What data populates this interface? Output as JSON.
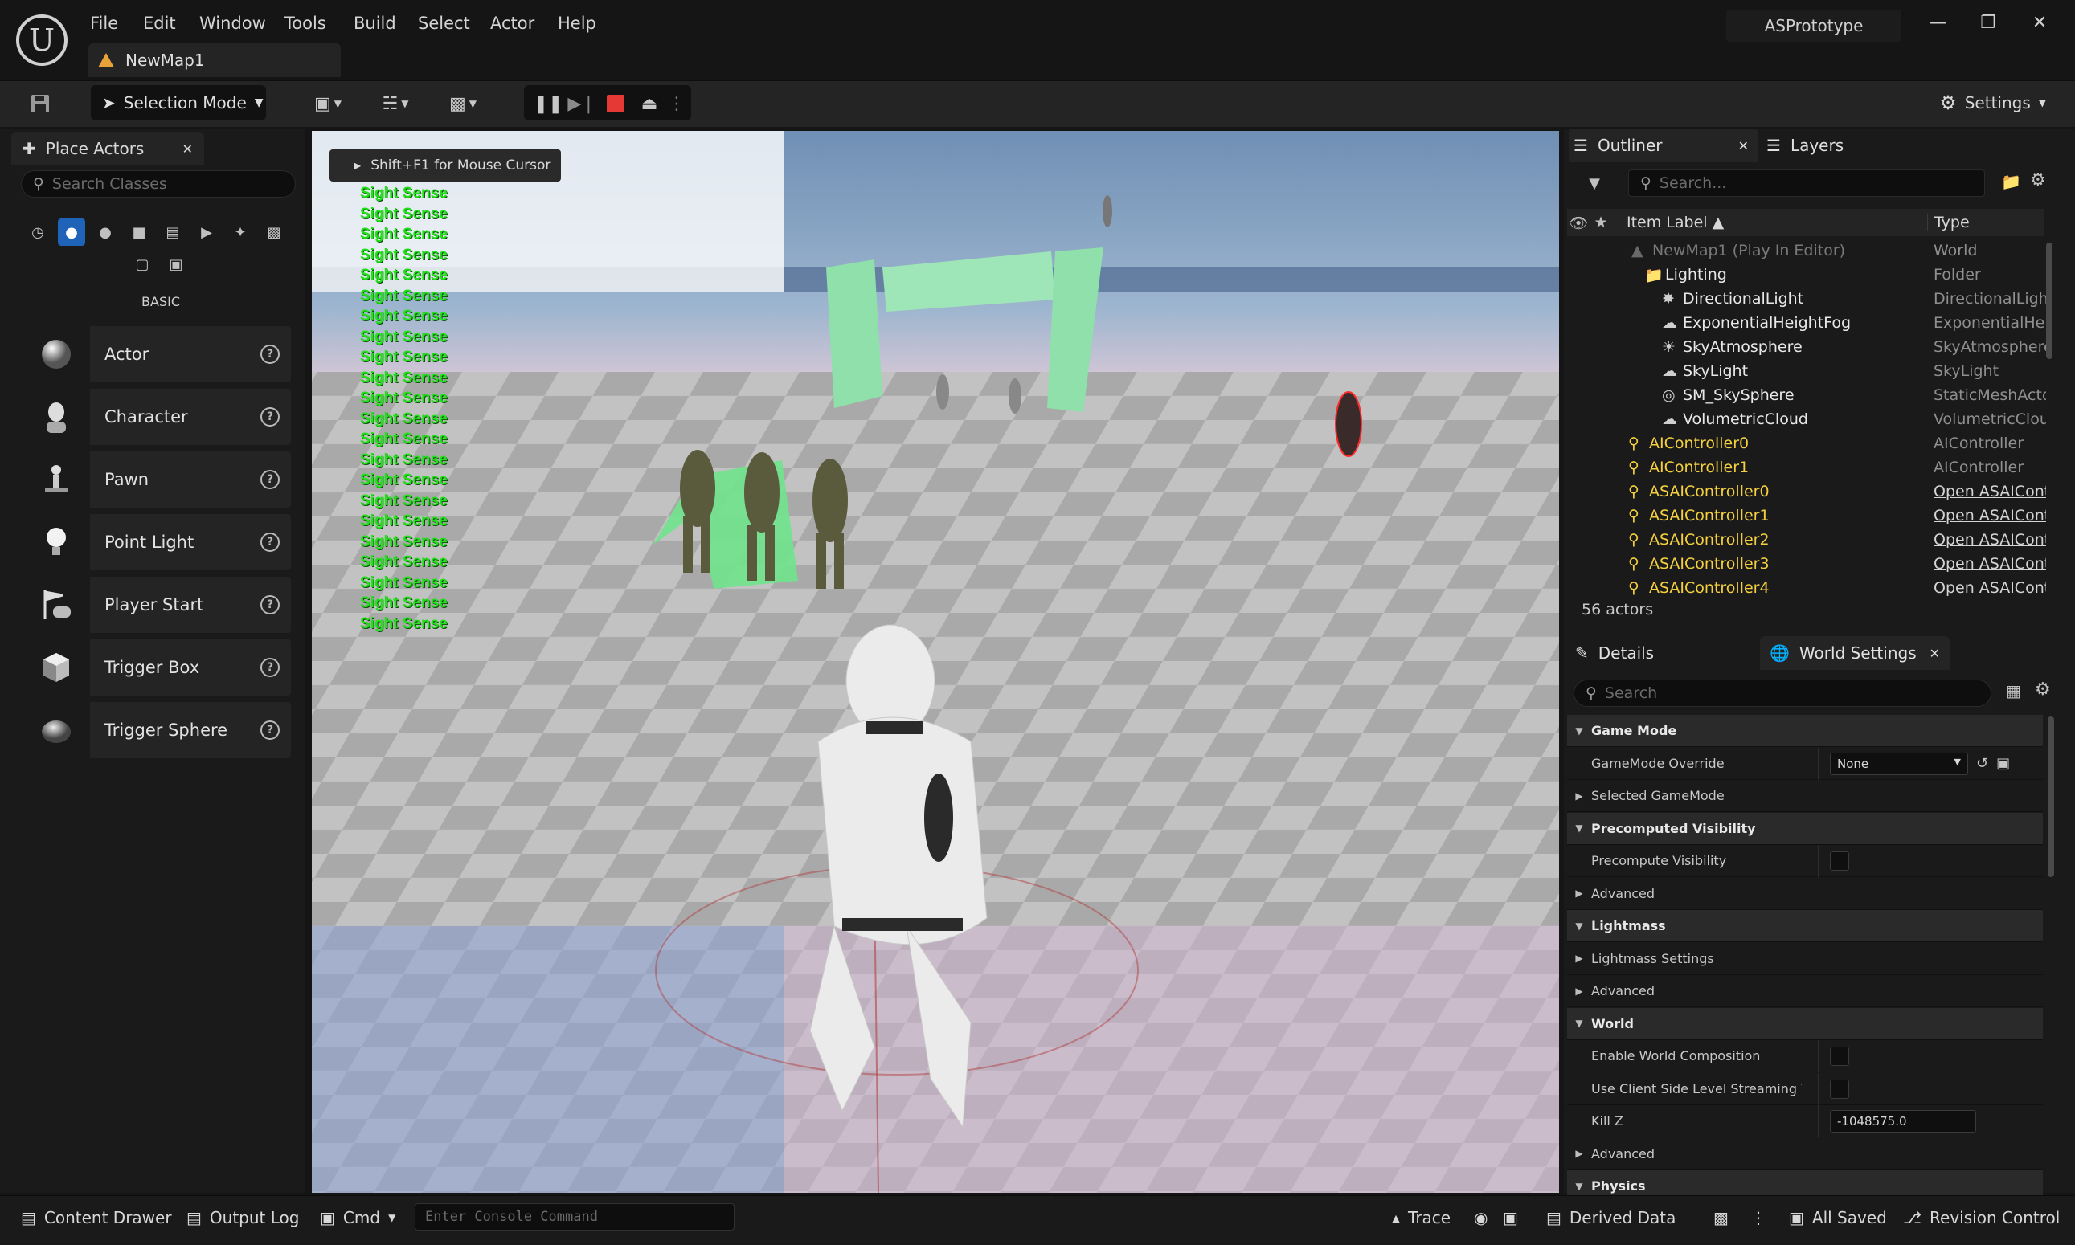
{
  "menu": [
    "File",
    "Edit",
    "Window",
    "Tools",
    "Build",
    "Select",
    "Actor",
    "Help"
  ],
  "project_name": "ASPrototype",
  "doc_tab": "NewMap1",
  "toolbar": {
    "selection_mode": "Selection Mode",
    "settings": "Settings"
  },
  "place_actors": {
    "tab_label": "Place Actors",
    "search_placeholder": "Search Classes",
    "category_label": "BASIC",
    "items": [
      "Actor",
      "Character",
      "Pawn",
      "Point Light",
      "Player Start",
      "Trigger Box",
      "Trigger Sphere"
    ]
  },
  "viewport": {
    "hint": "Shift+F1 for Mouse Cursor",
    "debug_lines": [
      "Sight Sense",
      "Sight Sense",
      "Sight Sense",
      "Sight Sense",
      "Sight Sense",
      "Sight Sense",
      "Sight Sense",
      "Sight Sense",
      "Sight Sense",
      "Sight Sense",
      "Sight Sense",
      "Sight Sense",
      "Sight Sense",
      "Sight Sense",
      "Sight Sense",
      "Sight Sense",
      "Sight Sense",
      "Sight Sense",
      "Sight Sense",
      "Sight Sense",
      "Sight Sense",
      "Sight Sense"
    ]
  },
  "outliner": {
    "tab_label": "Outliner",
    "layers_label": "Layers",
    "search_placeholder": "Search...",
    "col_label": "Item Label ▲",
    "col_type": "Type",
    "rows": [
      {
        "name": "NewMap1 (Play In Editor)",
        "type": "World"
      },
      {
        "name": "Lighting",
        "type": "Folder"
      },
      {
        "name": "DirectionalLight",
        "type": "DirectionalLight"
      },
      {
        "name": "ExponentialHeightFog",
        "type": "ExponentialHeig"
      },
      {
        "name": "SkyAtmosphere",
        "type": "SkyAtmosphere"
      },
      {
        "name": "SkyLight",
        "type": "SkyLight"
      },
      {
        "name": "SM_SkySphere",
        "type": "StaticMeshActo"
      },
      {
        "name": "VolumetricCloud",
        "type": "VolumetricClou"
      },
      {
        "name": "AIController0",
        "type": "AIController"
      },
      {
        "name": "AIController1",
        "type": "AIController"
      },
      {
        "name": "ASAIController0",
        "type": "Open ASAICont"
      },
      {
        "name": "ASAIController1",
        "type": "Open ASAICont"
      },
      {
        "name": "ASAIController2",
        "type": "Open ASAICont"
      },
      {
        "name": "ASAIController3",
        "type": "Open ASAICont"
      },
      {
        "name": "ASAIController4",
        "type": "Open ASAICont"
      }
    ],
    "actor_count": "56 actors"
  },
  "details": {
    "tab_label": "Details",
    "world_settings_label": "World Settings",
    "search_placeholder": "Search",
    "rows": [
      {
        "kind": "cat",
        "label": "Game Mode"
      },
      {
        "kind": "prop",
        "label": "GameMode Override",
        "value": "None"
      },
      {
        "kind": "sub",
        "label": "Selected GameMode"
      },
      {
        "kind": "cat",
        "label": "Precomputed Visibility"
      },
      {
        "kind": "prop",
        "label": "Precompute Visibility"
      },
      {
        "kind": "sub",
        "label": "Advanced"
      },
      {
        "kind": "cat",
        "label": "Lightmass"
      },
      {
        "kind": "sub",
        "label": "Lightmass Settings"
      },
      {
        "kind": "sub",
        "label": "Advanced"
      },
      {
        "kind": "cat",
        "label": "World"
      },
      {
        "kind": "prop",
        "label": "Enable World Composition"
      },
      {
        "kind": "prop",
        "label": "Use Client Side Level Streaming Vol..."
      },
      {
        "kind": "prop",
        "label": "Kill Z",
        "value": "-1048575.0"
      },
      {
        "kind": "sub",
        "label": "Advanced"
      },
      {
        "kind": "cat",
        "label": "Physics"
      }
    ]
  },
  "bottom": {
    "content_drawer": "Content Drawer",
    "output_log": "Output Log",
    "cmd": "Cmd",
    "console_placeholder": "Enter Console Command",
    "trace": "Trace",
    "derived_data": "Derived Data",
    "all_saved": "All Saved",
    "revision_control": "Revision Control"
  },
  "colors": {
    "accent": "#1e63b8",
    "sight_text": "#22e01a",
    "outliner_yellow": "#f4d03f",
    "stop_red": "#e53935"
  }
}
